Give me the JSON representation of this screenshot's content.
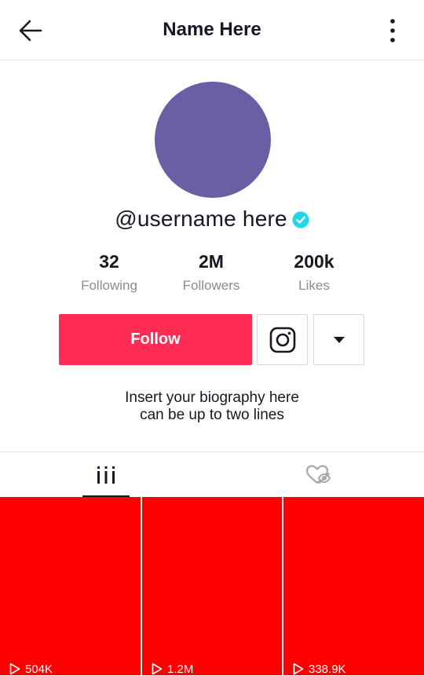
{
  "header": {
    "title": "Name Here",
    "back_icon": "arrow-left-icon",
    "more_icon": "vertical-dots-icon"
  },
  "profile": {
    "username": "@username here",
    "verified_icon": "verified-badge-icon",
    "avatar_color": "#6a5ea4",
    "stats": [
      {
        "value": "32",
        "label": "Following"
      },
      {
        "value": "2M",
        "label": "Followers"
      },
      {
        "value": "200k",
        "label": "Likes"
      }
    ],
    "follow_label": "Follow",
    "instagram_icon": "instagram-icon",
    "dropdown_icon": "caret-down-icon",
    "bio_lines": [
      "Insert your biography here",
      "can be up to two lines"
    ]
  },
  "tabs": [
    {
      "icon": "videos-grid-icon",
      "active": true
    },
    {
      "icon": "liked-hidden-icon",
      "active": false
    }
  ],
  "videos": [
    {
      "views": "504K"
    },
    {
      "views": "1.2M"
    },
    {
      "views": "338.9K"
    }
  ],
  "colors": {
    "accent": "#fe2c55",
    "verified": "#20d5ec",
    "tile": "#ff0000",
    "muted_text": "#8a8b91"
  }
}
